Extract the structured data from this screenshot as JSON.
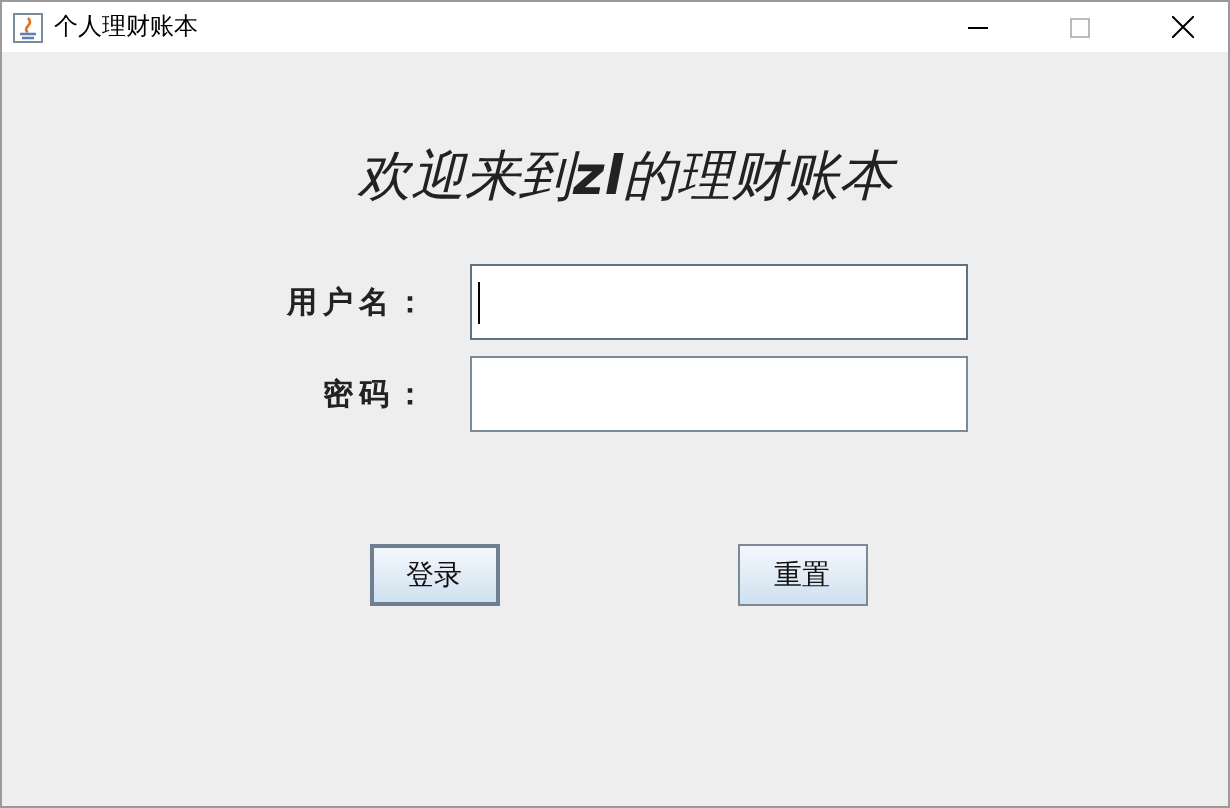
{
  "window": {
    "title": "个人理财账本"
  },
  "heading": "欢迎来到**zl**的理财账本",
  "fields": [
    {
      "label": "用户名：",
      "focused": true
    },
    {
      "label": "密码：",
      "focused": false
    }
  ],
  "buttons": [
    {
      "label": "登录",
      "focused": true
    },
    {
      "label": "重置",
      "focused": false
    }
  ]
}
